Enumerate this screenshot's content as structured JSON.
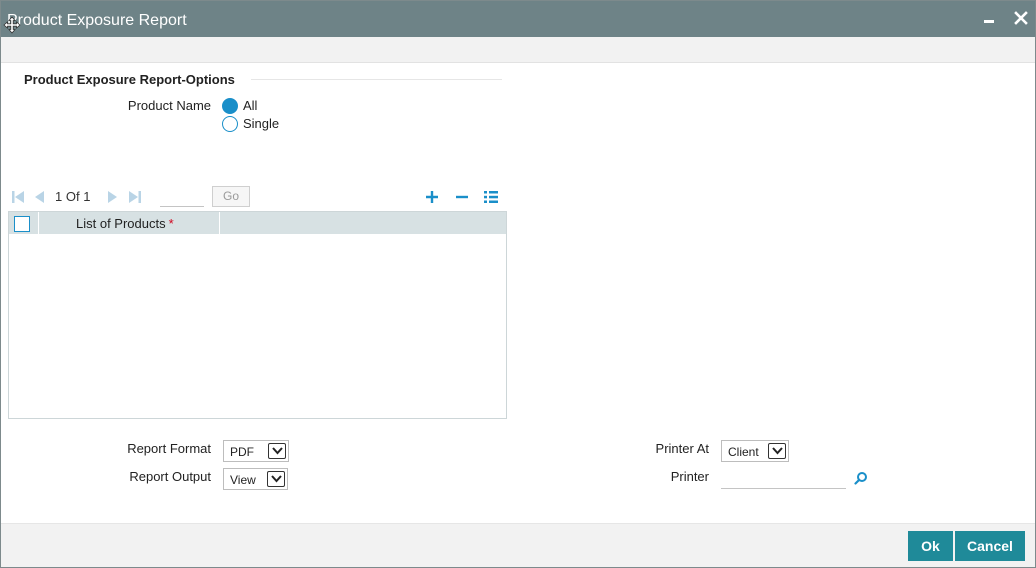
{
  "window": {
    "title": "Product Exposure Report"
  },
  "section": {
    "title": "Product Exposure Report-Options"
  },
  "product_name": {
    "label": "Product Name",
    "options": [
      {
        "label": "All",
        "selected": true
      },
      {
        "label": "Single",
        "selected": false
      }
    ]
  },
  "pager": {
    "current": "1",
    "of_label": "Of",
    "total": "1",
    "go_label": "Go"
  },
  "grid": {
    "columns": [
      {
        "label": "List of Products",
        "required_mark": "*"
      }
    ],
    "rows": []
  },
  "report_format": {
    "label": "Report Format",
    "value": "PDF"
  },
  "report_output": {
    "label": "Report Output",
    "value": "View"
  },
  "printer_at": {
    "label": "Printer At",
    "value": "Client"
  },
  "printer": {
    "label": "Printer",
    "value": ""
  },
  "buttons": {
    "ok": "Ok",
    "cancel": "Cancel"
  },
  "colors": {
    "titlebar": "#6e8387",
    "accent": "#1a8fc9",
    "button": "#1f8a99",
    "required": "#d0021b"
  }
}
